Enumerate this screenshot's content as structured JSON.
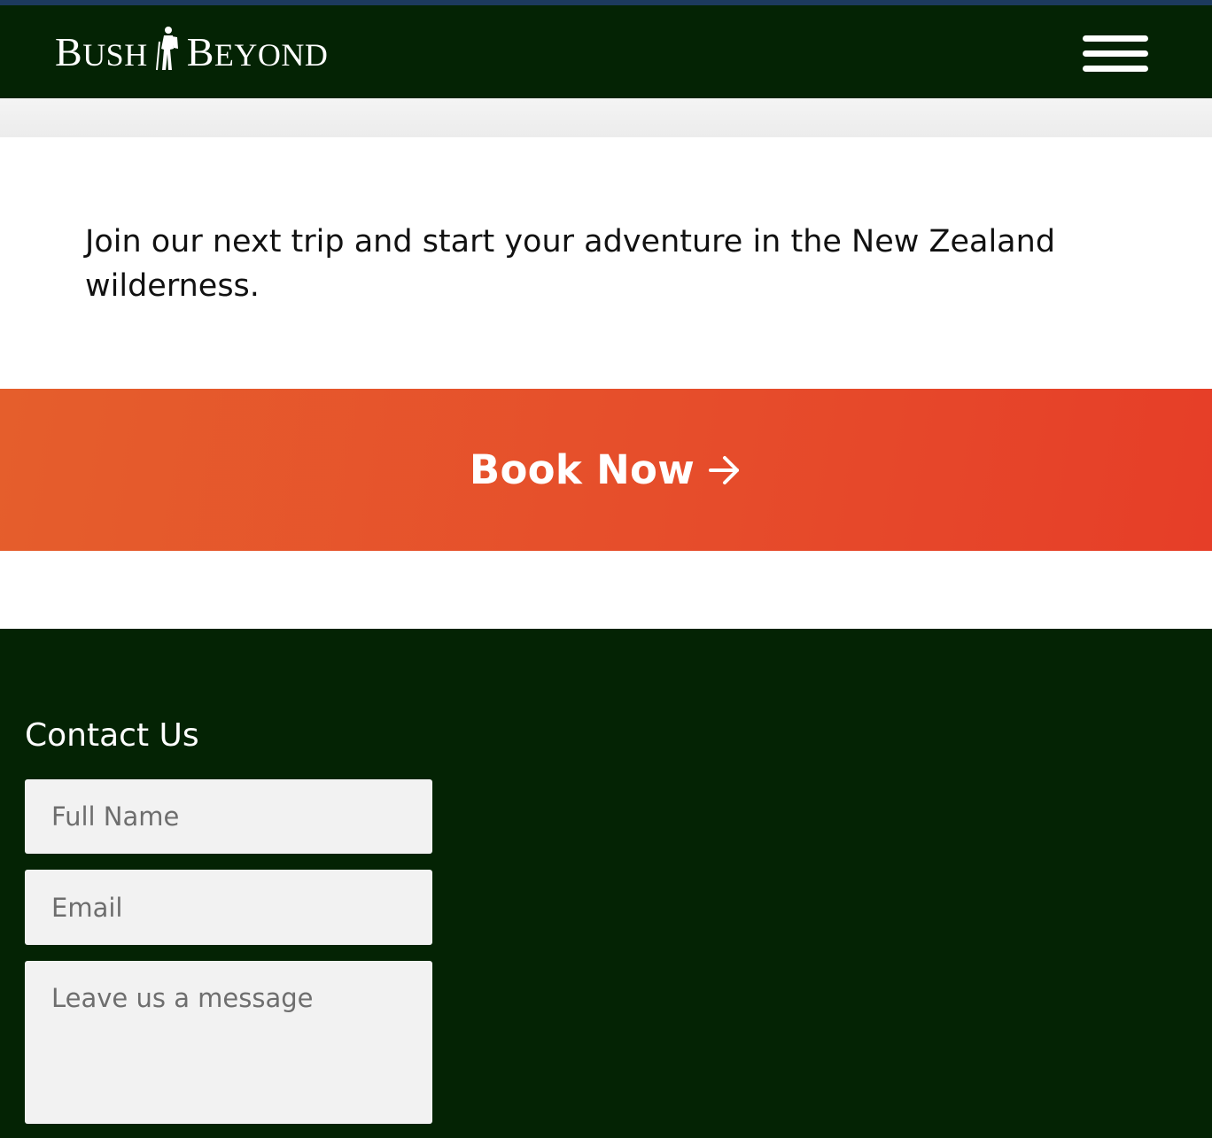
{
  "header": {
    "logo_left": "BUSH",
    "logo_right": "BEYOND",
    "menu_icon": "hamburger-menu-icon"
  },
  "intro": {
    "text": "Join our next trip and start your adventure in the New Zealand wilderness."
  },
  "cta": {
    "label": "Book Now",
    "icon": "arrow-right-icon"
  },
  "contact": {
    "title": "Contact Us",
    "name_placeholder": "Full Name",
    "email_placeholder": "Email",
    "message_placeholder": "Leave us a message"
  },
  "colors": {
    "header_bg": "#042304",
    "accent": "#e6502b",
    "field_bg": "#f2f2f2"
  }
}
